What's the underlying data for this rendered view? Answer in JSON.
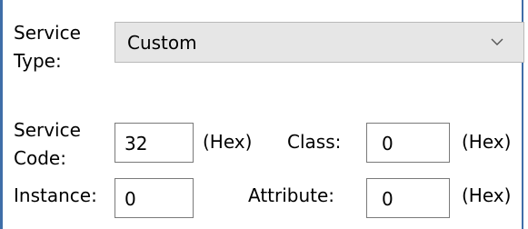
{
  "service_type": {
    "label_line1": "Service",
    "label_line2": "Type:",
    "selected": "Custom",
    "chevron_icon": "chevron-down-icon"
  },
  "service_code": {
    "label_line1": "Service",
    "label_line2": "Code:",
    "value": "32",
    "unit": "(Hex)"
  },
  "class": {
    "label": "Class:",
    "value": "0",
    "unit": "(Hex)"
  },
  "instance": {
    "label": "Instance:",
    "value": "0"
  },
  "attribute": {
    "label": "Attribute:",
    "value": "0",
    "unit": "(Hex)"
  },
  "colors": {
    "frame_border": "#3f6ea8",
    "dropdown_bg": "#e6e6e6",
    "field_border": "#7a7a7a"
  }
}
